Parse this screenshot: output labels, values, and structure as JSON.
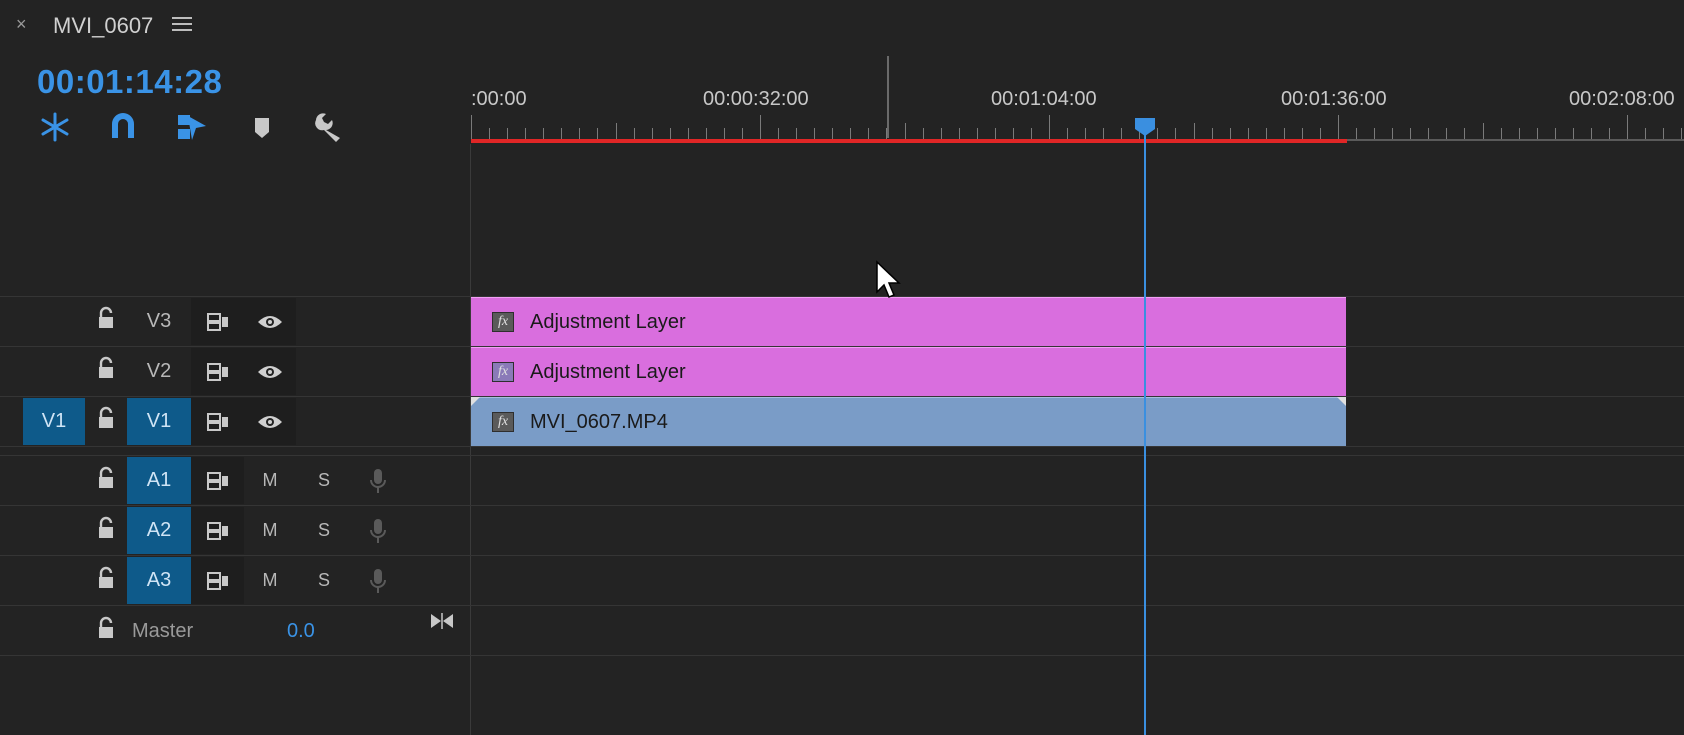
{
  "panel": {
    "close_glyph": "×",
    "sequence_title": "MVI_0607",
    "menu_icon": "hamburger-menu-icon",
    "timecode": "00:01:14:28"
  },
  "toolbar": {
    "tools": [
      {
        "name": "insert-overwrite-icon"
      },
      {
        "name": "snap-magnet-icon"
      },
      {
        "name": "linked-selection-icon"
      },
      {
        "name": "add-marker-icon"
      },
      {
        "name": "timeline-settings-wrench-icon"
      }
    ]
  },
  "ruler": {
    "labels": [
      ":00:00",
      "00:00:32:00",
      "00:01:04:00",
      "00:01:36:00",
      "00:02:08:00"
    ]
  },
  "tracks": {
    "video": [
      {
        "source": "",
        "label": "V3",
        "clip": "Adjustment Layer",
        "fx": "fx"
      },
      {
        "source": "",
        "label": "V2",
        "clip": "Adjustment Layer",
        "fx": "fx"
      },
      {
        "source": "V1",
        "label": "V1",
        "clip": "MVI_0607.MP4",
        "fx": "fx"
      }
    ],
    "audio": [
      {
        "label": "A1",
        "mute": "M",
        "solo": "S"
      },
      {
        "label": "A2",
        "mute": "M",
        "solo": "S"
      },
      {
        "label": "A3",
        "mute": "M",
        "solo": "S"
      }
    ],
    "master": {
      "label": "Master",
      "value": "0.0"
    }
  },
  "colors": {
    "accent": "#3a93e6",
    "adjustment_clip": "#d96ede",
    "video_clip": "#7a9cc7",
    "work_area": "#e02626",
    "target_on": "#0e5a8a"
  }
}
